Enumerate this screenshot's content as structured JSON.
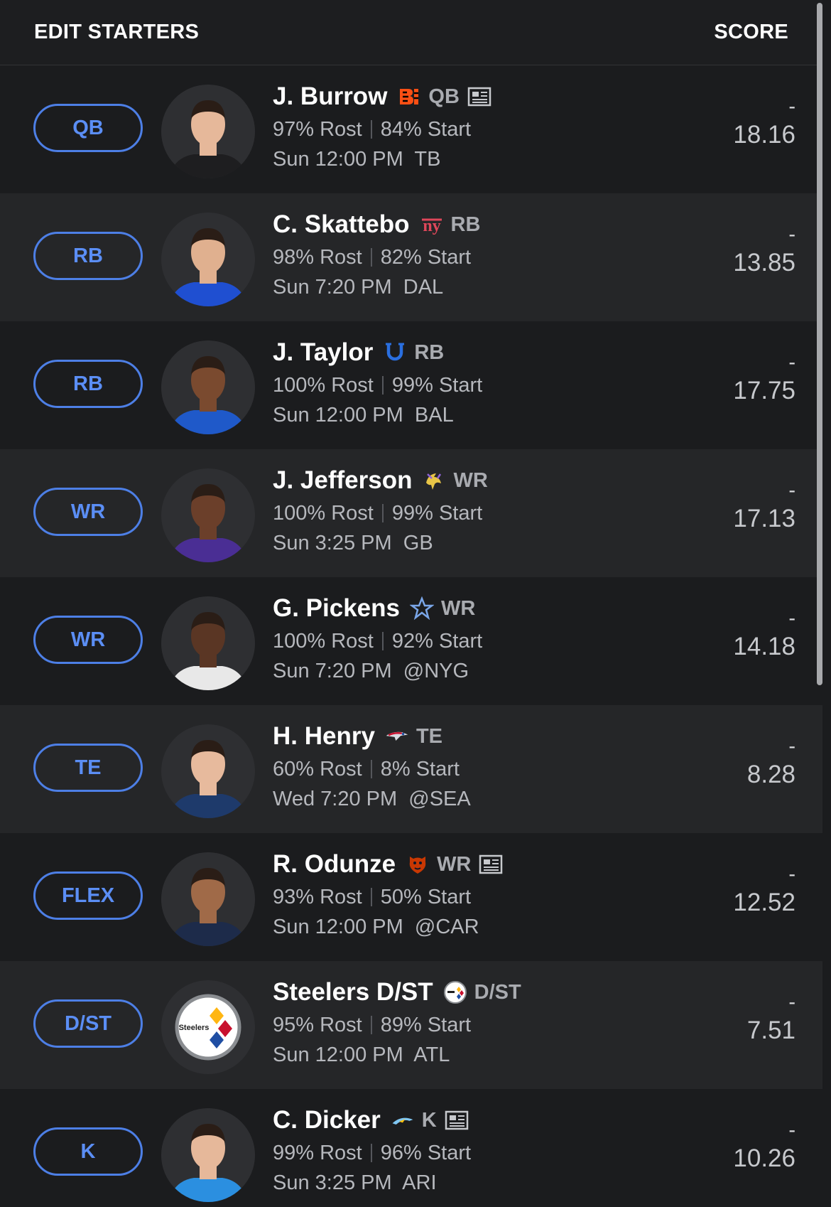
{
  "header": {
    "title": "EDIT STARTERS",
    "score_label": "SCORE"
  },
  "colors": {
    "accent": "#4d7fe6",
    "bg_dark": "#1b1c1e",
    "bg_light": "#252628"
  },
  "rows": [
    {
      "slot": "QB",
      "name": "J. Burrow",
      "team_icon": "bengals-logo",
      "position": "QB",
      "has_news": true,
      "rost": "97% Rost",
      "start": "84% Start",
      "game": "Sun 12:00 PM  TB",
      "dash": "-",
      "score": "18.16"
    },
    {
      "slot": "RB",
      "name": "C. Skattebo",
      "team_icon": "giants-logo",
      "position": "RB",
      "has_news": false,
      "rost": "98% Rost",
      "start": "82% Start",
      "game": "Sun 7:20 PM  DAL",
      "dash": "-",
      "score": "13.85"
    },
    {
      "slot": "RB",
      "name": "J. Taylor",
      "team_icon": "colts-logo",
      "position": "RB",
      "has_news": false,
      "rost": "100% Rost",
      "start": "99% Start",
      "game": "Sun 12:00 PM  BAL",
      "dash": "-",
      "score": "17.75"
    },
    {
      "slot": "WR",
      "name": "J. Jefferson",
      "team_icon": "vikings-logo",
      "position": "WR",
      "has_news": false,
      "rost": "100% Rost",
      "start": "99% Start",
      "game": "Sun 3:25 PM  GB",
      "dash": "-",
      "score": "17.13"
    },
    {
      "slot": "WR",
      "name": "G. Pickens",
      "team_icon": "cowboys-logo",
      "position": "WR",
      "has_news": false,
      "rost": "100% Rost",
      "start": "92% Start",
      "game": "Sun 7:20 PM  @NYG",
      "dash": "-",
      "score": "14.18"
    },
    {
      "slot": "TE",
      "name": "H. Henry",
      "team_icon": "patriots-logo",
      "position": "TE",
      "has_news": false,
      "rost": "60% Rost",
      "start": "8% Start",
      "game": "Wed 7:20 PM  @SEA",
      "dash": "-",
      "score": "8.28"
    },
    {
      "slot": "FLEX",
      "name": "R. Odunze",
      "team_icon": "bears-logo",
      "position": "WR",
      "has_news": true,
      "rost": "93% Rost",
      "start": "50% Start",
      "game": "Sun 12:00 PM  @CAR",
      "dash": "-",
      "score": "12.52"
    },
    {
      "slot": "D/ST",
      "name": "Steelers D/ST",
      "team_icon": "steelers-logo",
      "position": "D/ST",
      "has_news": false,
      "rost": "95% Rost",
      "start": "89% Start",
      "game": "Sun 12:00 PM  ATL",
      "dash": "-",
      "score": "7.51"
    },
    {
      "slot": "K",
      "name": "C. Dicker",
      "team_icon": "chargers-logo",
      "position": "K",
      "has_news": true,
      "rost": "99% Rost",
      "start": "96% Start",
      "game": "Sun 3:25 PM  ARI",
      "dash": "-",
      "score": "10.26"
    }
  ]
}
